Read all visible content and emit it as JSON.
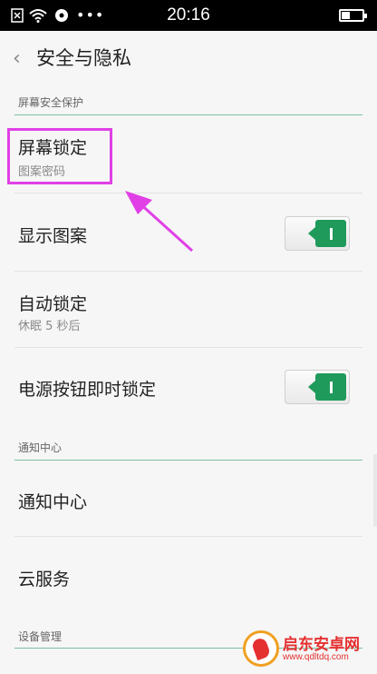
{
  "status_bar": {
    "time": "20:16",
    "icons": [
      "sim-close-icon",
      "wifi-icon",
      "cloud-icon",
      "more-dots-icon",
      "battery-icon"
    ],
    "dots": "•••"
  },
  "header": {
    "back_icon": "‹",
    "title": "安全与隐私"
  },
  "sections": [
    {
      "label": "屏幕安全保护"
    },
    {
      "label": "通知中心"
    },
    {
      "label": "设备管理"
    }
  ],
  "rows": {
    "screen_lock": {
      "title": "屏幕锁定",
      "subtitle": "图案密码"
    },
    "show_pattern": {
      "title": "显示图案",
      "toggle": "on"
    },
    "auto_lock": {
      "title": "自动锁定",
      "subtitle": "休眠 5 秒后"
    },
    "power_lock": {
      "title": "电源按钮即时锁定",
      "toggle": "on"
    },
    "notification": {
      "title": "通知中心"
    },
    "cloud": {
      "title": "云服务"
    }
  },
  "annotation": {
    "highlight_color": "#e040e6"
  },
  "colors": {
    "accent": "#1f9a5b",
    "section_line": "#7bbfa0"
  },
  "watermark": {
    "name": "启东安卓网",
    "url": "www.qdltdq.com"
  }
}
